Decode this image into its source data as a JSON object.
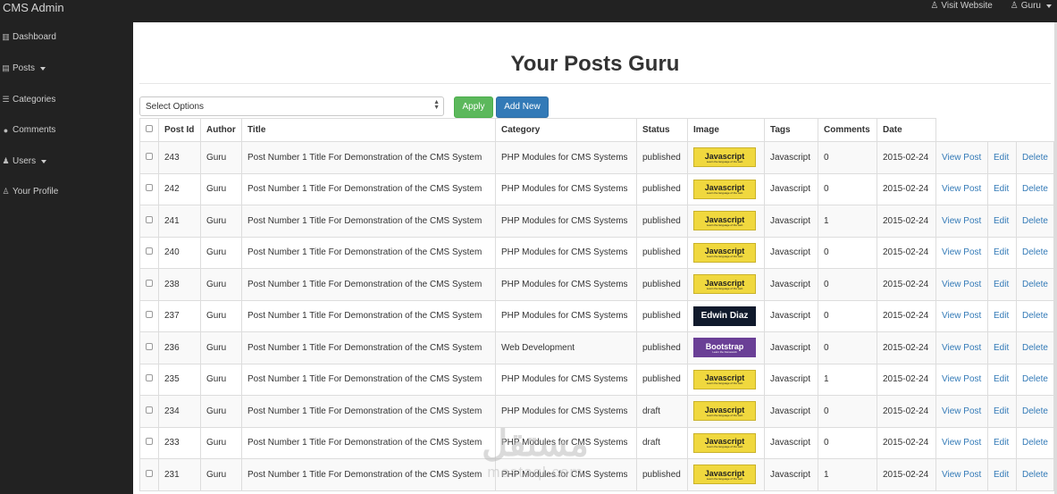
{
  "app": {
    "brand": "CMS Admin"
  },
  "topnav": {
    "visit_website": "Visit Website",
    "user": "Guru"
  },
  "sidebar": {
    "items": [
      {
        "label": "Dashboard",
        "icon": "bar-chart-icon",
        "glyph": "▥",
        "caret": false
      },
      {
        "label": "Posts",
        "icon": "file-icon",
        "glyph": "▤",
        "caret": true
      },
      {
        "label": "Categories",
        "icon": "list-icon",
        "glyph": "☰",
        "caret": false
      },
      {
        "label": "Comments",
        "icon": "comments-icon",
        "glyph": "●",
        "caret": false
      },
      {
        "label": "Users",
        "icon": "users-icon",
        "glyph": "♟",
        "caret": true
      },
      {
        "label": "Your Profile",
        "icon": "user-icon",
        "glyph": "♙",
        "caret": false
      }
    ]
  },
  "main": {
    "title": "Your Posts Guru",
    "bulk_select": {
      "value": "Select Options"
    },
    "apply_label": "Apply",
    "add_new_label": "Add New"
  },
  "table": {
    "headers": [
      "Post Id",
      "Author",
      "Title",
      "Category",
      "Status",
      "Image",
      "Tags",
      "Comments",
      "Date"
    ],
    "action_labels": {
      "view": "View Post",
      "edit": "Edit",
      "delete": "Delete"
    },
    "rows": [
      {
        "id": "243",
        "author": "Guru",
        "title": "Post Number 1 Title For Demonstration of the CMS System",
        "category": "PHP Modules for CMS Systems",
        "status": "published",
        "image": "javascript",
        "tags": "Javascript",
        "comments": "0",
        "date": "2015-02-24"
      },
      {
        "id": "242",
        "author": "Guru",
        "title": "Post Number 1 Title For Demonstration of the CMS System",
        "category": "PHP Modules for CMS Systems",
        "status": "published",
        "image": "javascript",
        "tags": "Javascript",
        "comments": "0",
        "date": "2015-02-24"
      },
      {
        "id": "241",
        "author": "Guru",
        "title": "Post Number 1 Title For Demonstration of the CMS System",
        "category": "PHP Modules for CMS Systems",
        "status": "published",
        "image": "javascript",
        "tags": "Javascript",
        "comments": "1",
        "date": "2015-02-24"
      },
      {
        "id": "240",
        "author": "Guru",
        "title": "Post Number 1 Title For Demonstration of the CMS System",
        "category": "PHP Modules for CMS Systems",
        "status": "published",
        "image": "javascript",
        "tags": "Javascript",
        "comments": "0",
        "date": "2015-02-24"
      },
      {
        "id": "238",
        "author": "Guru",
        "title": "Post Number 1 Title For Demonstration of the CMS System",
        "category": "PHP Modules for CMS Systems",
        "status": "published",
        "image": "javascript",
        "tags": "Javascript",
        "comments": "0",
        "date": "2015-02-24"
      },
      {
        "id": "237",
        "author": "Guru",
        "title": "Post Number 1 Title For Demonstration of the CMS System",
        "category": "PHP Modules for CMS Systems",
        "status": "published",
        "image": "edwin",
        "tags": "Javascript",
        "comments": "0",
        "date": "2015-02-24"
      },
      {
        "id": "236",
        "author": "Guru",
        "title": "Post Number 1 Title For Demonstration of the CMS System",
        "category": "Web Development",
        "status": "published",
        "image": "bootstrap",
        "tags": "Javascript",
        "comments": "0",
        "date": "2015-02-24"
      },
      {
        "id": "235",
        "author": "Guru",
        "title": "Post Number 1 Title For Demonstration of the CMS System",
        "category": "PHP Modules for CMS Systems",
        "status": "published",
        "image": "javascript",
        "tags": "Javascript",
        "comments": "1",
        "date": "2015-02-24"
      },
      {
        "id": "234",
        "author": "Guru",
        "title": "Post Number 1 Title For Demonstration of the CMS System",
        "category": "PHP Modules for CMS Systems",
        "status": "draft",
        "image": "javascript",
        "tags": "Javascript",
        "comments": "0",
        "date": "2015-02-24"
      },
      {
        "id": "233",
        "author": "Guru",
        "title": "Post Number 1 Title For Demonstration of the CMS System",
        "category": "PHP Modules for CMS Systems",
        "status": "draft",
        "image": "javascript",
        "tags": "Javascript",
        "comments": "0",
        "date": "2015-02-24"
      },
      {
        "id": "231",
        "author": "Guru",
        "title": "Post Number 1 Title For Demonstration of the CMS System",
        "category": "PHP Modules for CMS Systems",
        "status": "published",
        "image": "javascript",
        "tags": "Javascript",
        "comments": "1",
        "date": "2015-02-24"
      }
    ]
  },
  "thumbnails": {
    "javascript": {
      "label": "Javascript",
      "sub": "Learn the language of the web"
    },
    "edwin": {
      "label": "Edwin Diaz",
      "sub": ""
    },
    "bootstrap": {
      "label": "Bootstrap",
      "sub": "Learn the framework"
    }
  },
  "watermark": {
    "mark": "مستقل",
    "text": "mostaql.com"
  },
  "colors": {
    "sidebar_bg": "#222222",
    "apply": "#5cb85c",
    "add_new": "#337ab7",
    "link": "#337ab7",
    "thumb_js": "#f0d83e",
    "thumb_edwin": "#101a2c",
    "thumb_bootstrap": "#6a3f96"
  }
}
